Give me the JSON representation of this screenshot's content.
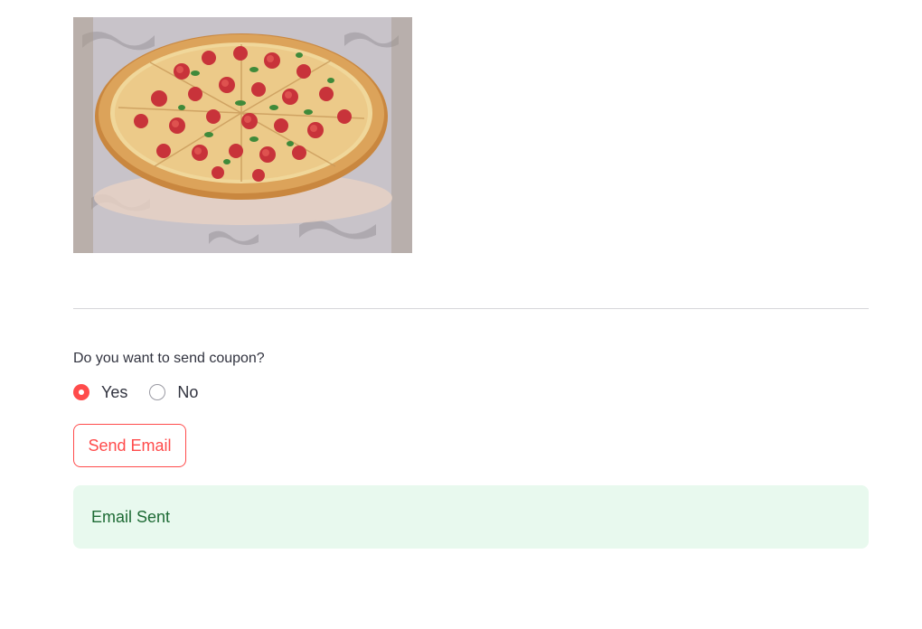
{
  "image": {
    "subject": "pepperoni-pizza-image"
  },
  "form": {
    "question": "Do you want to send coupon?",
    "options": [
      {
        "label": "Yes",
        "selected": true
      },
      {
        "label": "No",
        "selected": false
      }
    ],
    "send_button_label": "Send Email"
  },
  "alert": {
    "message": "Email Sent"
  },
  "colors": {
    "accent": "#ff4b4b",
    "success_bg": "#e8f9ee",
    "success_text": "#1e6b35",
    "text": "#31333f",
    "divider": "#d6d6d9"
  }
}
